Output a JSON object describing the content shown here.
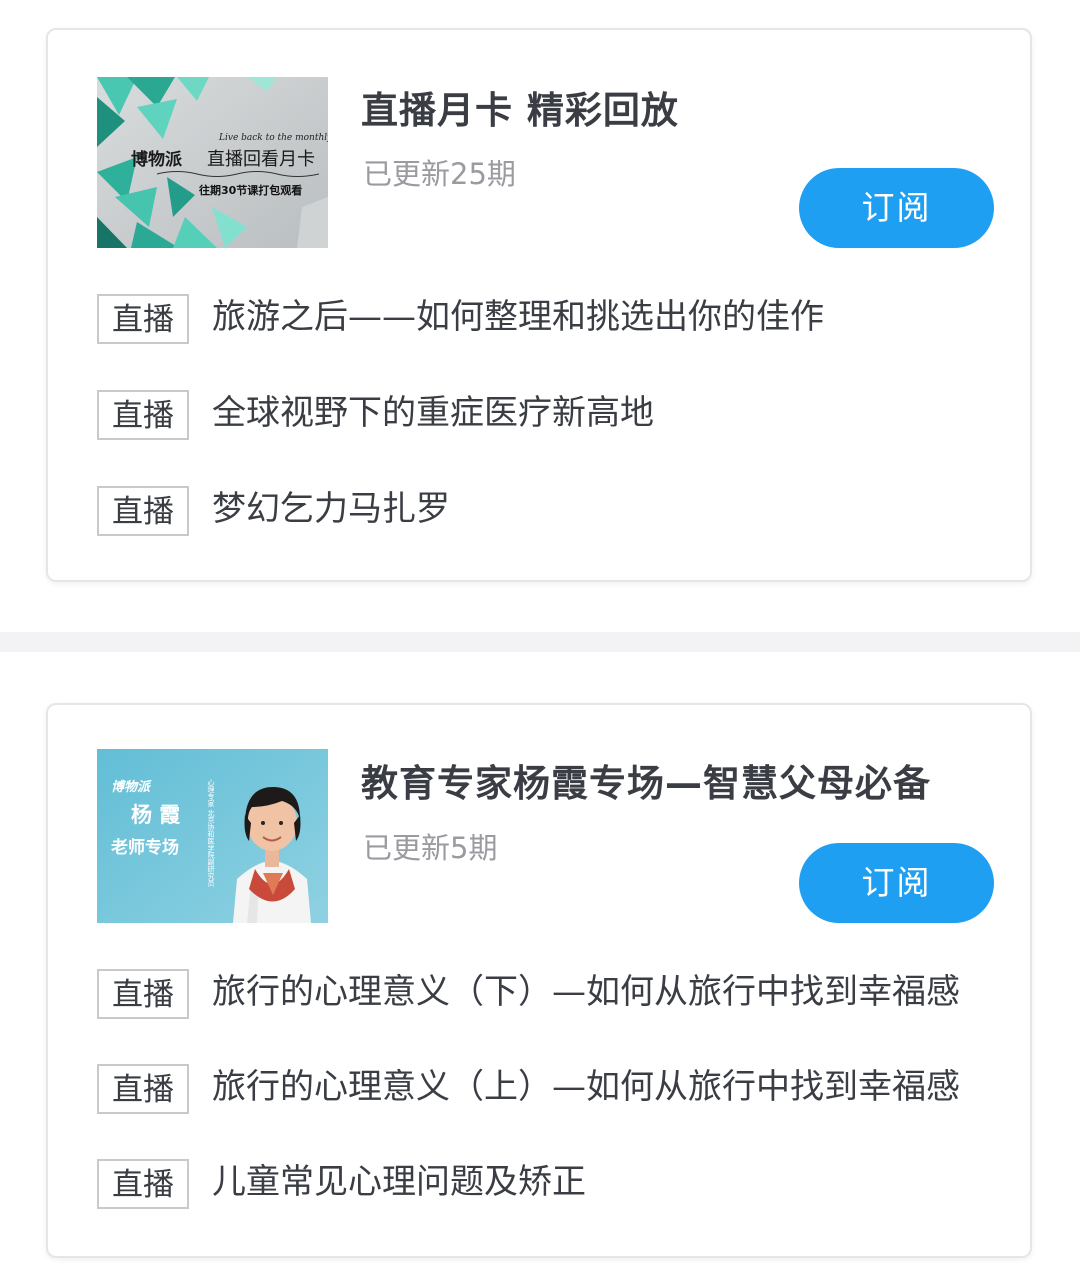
{
  "courses": [
    {
      "title": "直播月卡 精彩回放",
      "updated": "已更新25期",
      "subscribe_label": "订阅",
      "cover": {
        "brand": "博物派",
        "heading": "直播回看月卡",
        "english": "Live back to the monthly card",
        "caption": "往期30节课打包观看",
        "colors": {
          "accent": "#3bbfa8",
          "dark": "#1a7f72",
          "background": "#c7ccce"
        }
      },
      "episodes": [
        {
          "tag": "直播",
          "title": "旅游之后——如何整理和挑选出你的佳作"
        },
        {
          "tag": "直播",
          "title": "全球视野下的重症医疗新高地"
        },
        {
          "tag": "直播",
          "title": "梦幻乞力马扎罗"
        }
      ]
    },
    {
      "title": "教育专家杨霞专场—智慧父母必备",
      "updated": "已更新5期",
      "subscribe_label": "订阅",
      "cover": {
        "brand": "博物派",
        "name": "杨 霞",
        "subtitle": "老师专场",
        "side_text": "心理专家 北京协和医学院副研究员",
        "colors": {
          "background": "#6cc3d9",
          "light": "#b5e2ec"
        }
      },
      "episodes": [
        {
          "tag": "直播",
          "title": "旅行的心理意义（下）—如何从旅行中找到幸福感"
        },
        {
          "tag": "直播",
          "title": "旅行的心理意义（上）—如何从旅行中找到幸福感"
        },
        {
          "tag": "直播",
          "title": "儿童常见心理问题及矫正"
        }
      ]
    }
  ],
  "theme": {
    "button_color": "#1f9ff2",
    "title_color": "#3a3d44",
    "muted_color": "#9a9ba0"
  }
}
